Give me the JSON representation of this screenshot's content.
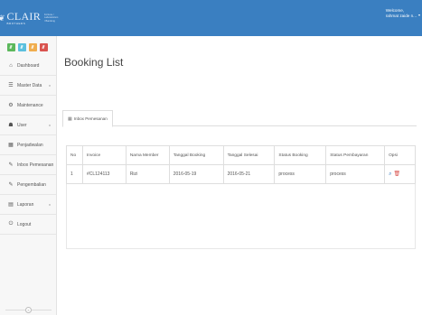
{
  "brand": {
    "logo_text": "CLAIR",
    "logo_sub": "BROTHERS",
    "logo_small": "Fortune / Laboratorium / Bandung"
  },
  "header": {
    "welcome_line1": "Welcome,",
    "welcome_line2": "rahmat zaide n...",
    "caret": "▾",
    "bar_color": "#3a7fc1"
  },
  "sidebar": {
    "quick_buttons": [
      {
        "name": "quick-stats-button",
        "color": "#5cb85c"
      },
      {
        "name": "quick-edit-button",
        "color": "#5bc0de"
      },
      {
        "name": "quick-users-button",
        "color": "#f0ad4e"
      },
      {
        "name": "quick-settings-button",
        "color": "#d9534f"
      }
    ],
    "items": [
      {
        "label": "Dashboard",
        "icon": "⌂",
        "icon_name": "home-icon",
        "has_submenu": false
      },
      {
        "label": "Master Data",
        "icon": "☰",
        "icon_name": "list-icon",
        "has_submenu": true
      },
      {
        "label": "Maintenance",
        "icon": "⚙",
        "icon_name": "gear-icon",
        "has_submenu": false
      },
      {
        "label": "User",
        "icon": "👥",
        "icon_name": "users-icon",
        "has_submenu": true
      },
      {
        "label": "Penjadwalan",
        "icon": "▦",
        "icon_name": "calendar-icon",
        "has_submenu": false
      },
      {
        "label": "Inbox Pemesanan",
        "icon": "✎",
        "icon_name": "pencil-icon",
        "has_submenu": false
      },
      {
        "label": "Pengembalian",
        "icon": "✎",
        "icon_name": "pencil-icon",
        "has_submenu": false
      },
      {
        "label": "Laporan",
        "icon": "▤",
        "icon_name": "report-icon",
        "has_submenu": true
      },
      {
        "label": "Logout",
        "icon": "⏻",
        "icon_name": "logout-icon",
        "has_submenu": false
      }
    ],
    "submenu_chevron": "v",
    "collapse_icon": "«"
  },
  "main": {
    "page_title": "Booking List",
    "tab": {
      "label": "Inbox Pemesanan",
      "icon": "▦"
    },
    "table": {
      "columns": [
        "No",
        "Invoice",
        "Nama Member",
        "Tanggal Booking",
        "Tanggal Selesai",
        "Status Booking",
        "Status Pembayaran",
        "Opsi"
      ],
      "rows": [
        {
          "no": "1",
          "invoice": "#CL124113",
          "member": "Rizi",
          "tanggal_booking": "2016-05-19",
          "tanggal_selesai": "2016-05-21",
          "status_booking": "process",
          "status_pembayaran": "process"
        }
      ],
      "view_icon": "🔍",
      "delete_icon": "🗑"
    }
  }
}
